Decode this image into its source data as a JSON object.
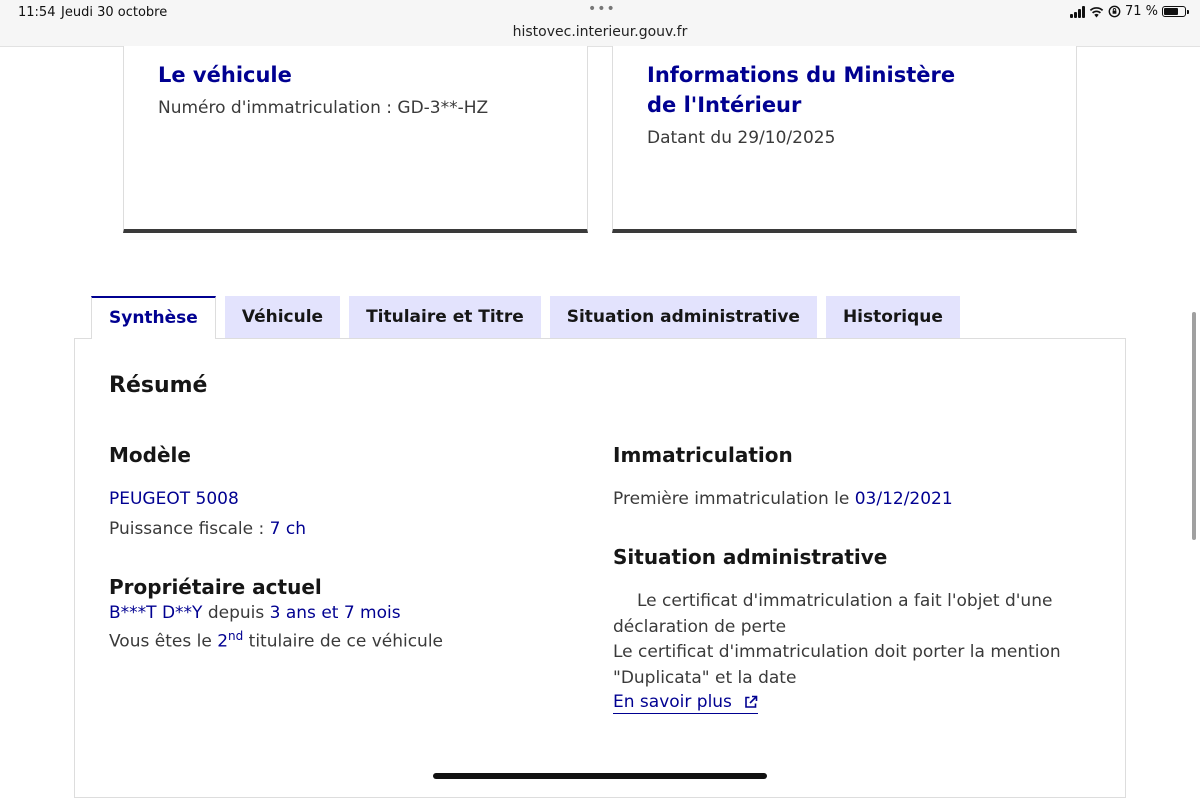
{
  "status_bar": {
    "time": "11:54",
    "date": "Jeudi 30 octobre",
    "dots": "•••",
    "url": "histovec.interieur.gouv.fr",
    "battery": "71 %",
    "battery_level": 0.71
  },
  "card_vehicle": {
    "title": "Le véhicule",
    "plate_text": "Numéro d'immatriculation : GD-3**-HZ"
  },
  "card_ministry": {
    "title": "Informations du Ministère de l'Intérieur",
    "date_text": "Datant du 29/10/2025"
  },
  "tabs": [
    {
      "label": "Synthèse",
      "active": true
    },
    {
      "label": "Véhicule",
      "active": false
    },
    {
      "label": "Titulaire et Titre",
      "active": false
    },
    {
      "label": "Situation administrative",
      "active": false
    },
    {
      "label": "Historique",
      "active": false
    }
  ],
  "summary": {
    "heading": "Résumé",
    "model": {
      "heading": "Modèle",
      "name": "PEUGEOT 5008",
      "power_label": "Puissance fiscale : ",
      "power_value": "7 ch"
    },
    "owner": {
      "heading": "Propriétaire actuel",
      "name": "B***T D**Y",
      "since_label": " depuis ",
      "since_value": "3 ans et 7 mois",
      "holder_prefix": "Vous êtes le ",
      "holder_num": "2",
      "holder_sup": "nd",
      "holder_suffix": " titulaire de ce véhicule"
    },
    "registration": {
      "heading": "Immatriculation",
      "first_label": "Première immatriculation le ",
      "first_date": "03/12/2021"
    },
    "admin": {
      "heading": "Situation administrative",
      "line1": "Le certificat d'immatriculation a fait l'objet d'une",
      "line2": "déclaration de perte",
      "line3": "Le certificat d'immatriculation doit porter la mention",
      "line4": "\"Duplicata\" et la date",
      "link": "En savoir plus"
    }
  },
  "colors": {
    "accent": "#000091",
    "tab_bg": "#e3e3fd",
    "text": "#3a3a3a",
    "heading": "#161616"
  }
}
